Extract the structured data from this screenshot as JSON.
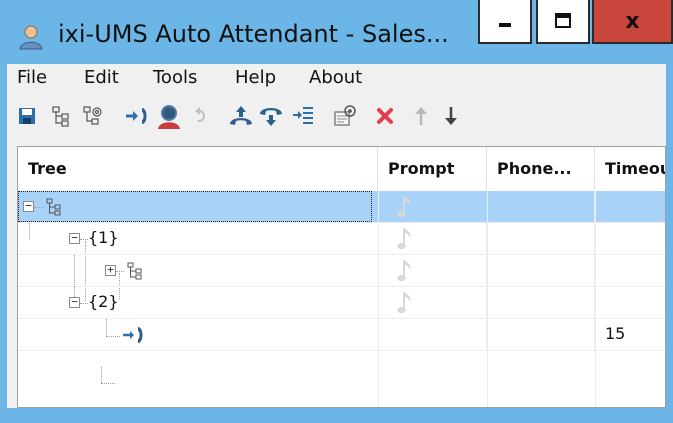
{
  "window": {
    "title": "ixi-UMS Auto Attendant - Sales...",
    "minimize_label": "minimize",
    "maximize_label": "maximize",
    "close_label": "x"
  },
  "menu": {
    "items": [
      {
        "label": "File"
      },
      {
        "label": "Edit"
      },
      {
        "label": "Tools"
      },
      {
        "label": "Help"
      },
      {
        "label": "About"
      }
    ]
  },
  "toolbar": {
    "icons": [
      "save-icon",
      "tree-icon",
      "tree-settings-icon",
      "transfer-icon",
      "agent-icon",
      "undo-icon",
      "pickup-icon",
      "hangup-icon",
      "menu-insert-icon",
      "properties-icon",
      "delete-icon",
      "move-up-icon",
      "move-down-icon"
    ]
  },
  "grid": {
    "columns": [
      {
        "label": "Tree"
      },
      {
        "label": "Prompt"
      },
      {
        "label": "Phone..."
      },
      {
        "label": "Timeou"
      }
    ],
    "rows": [
      {
        "label": "",
        "timeout": ""
      },
      {
        "label": "{1}",
        "timeout": ""
      },
      {
        "label": "",
        "timeout": ""
      },
      {
        "label": "{2}",
        "timeout": ""
      },
      {
        "label": "",
        "timeout": "15"
      }
    ]
  },
  "colors": {
    "window_frame": "#6bb6e6",
    "close_button": "#c9463d",
    "selection": "#a8d2f7",
    "icon_blue": "#2d6da8"
  }
}
